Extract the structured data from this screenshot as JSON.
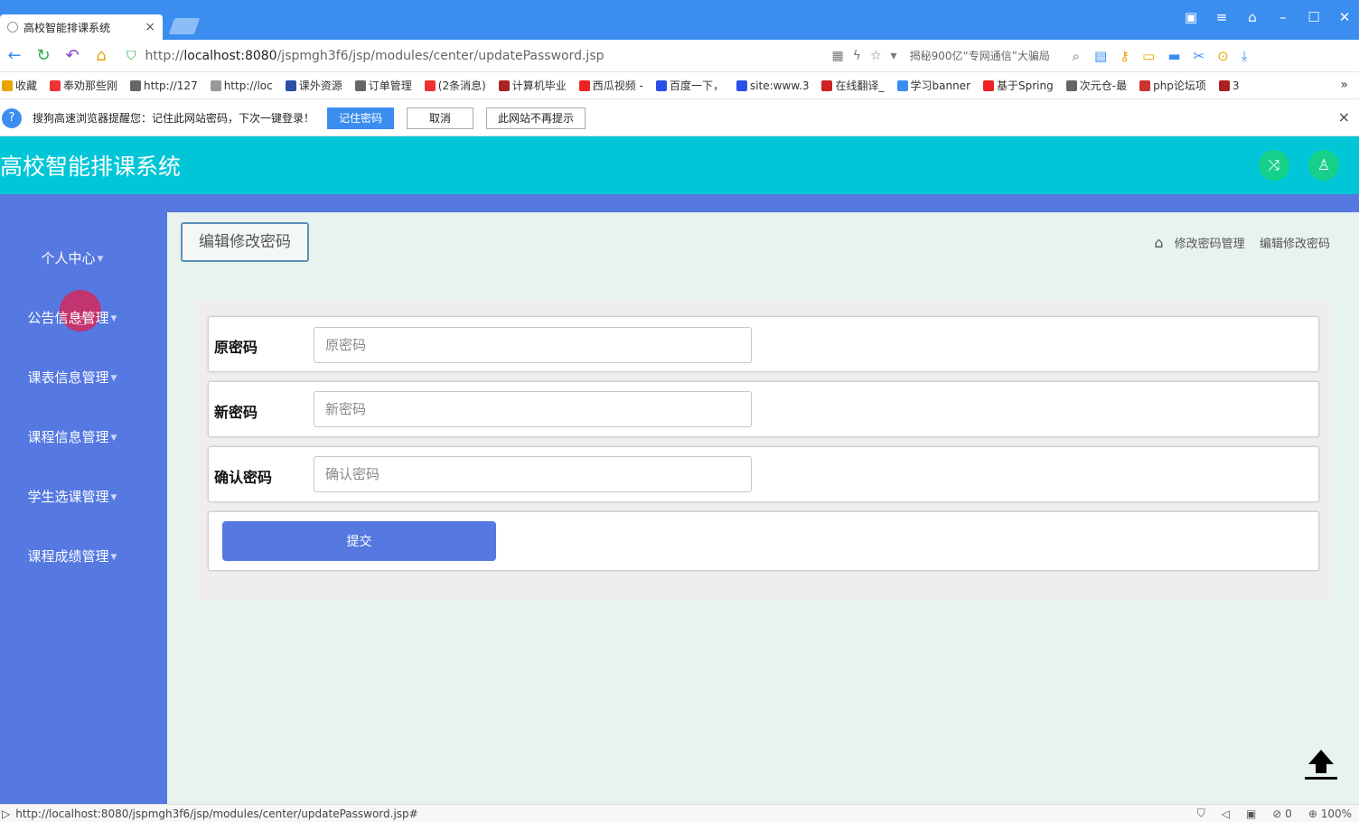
{
  "browser": {
    "tab_title": "高校智能排课系统",
    "tab_close": "×",
    "url_prefix": "http://",
    "url_host": "localhost:8080",
    "url_path": "/jspmgh3f6/jsp/modules/center/updatePassword.jsp",
    "search_hint": "揭秘900亿“专网通信”大骗局",
    "bookmarks": [
      {
        "label": "收藏",
        "color": "#e8a400"
      },
      {
        "label": "奉劝那些刚",
        "color": "#e33"
      },
      {
        "label": "http://127",
        "color": "#666"
      },
      {
        "label": "http://loc",
        "color": "#999"
      },
      {
        "label": "课外资源",
        "color": "#2a4fa8"
      },
      {
        "label": "订单管理",
        "color": "#666"
      },
      {
        "label": "(2条消息)",
        "color": "#e33"
      },
      {
        "label": "计算机毕业",
        "color": "#a22"
      },
      {
        "label": "西瓜视频 -",
        "color": "#e22"
      },
      {
        "label": "百度一下，",
        "color": "#2a4fe8"
      },
      {
        "label": "site:www.3",
        "color": "#2a4fe8"
      },
      {
        "label": "在线翻译_",
        "color": "#c22"
      },
      {
        "label": "学习banner",
        "color": "#3b8ef0"
      },
      {
        "label": "基于Spring",
        "color": "#e22"
      },
      {
        "label": "次元仓-最",
        "color": "#666"
      },
      {
        "label": "php论坛项",
        "color": "#c33"
      },
      {
        "label": "3",
        "color": "#a22"
      }
    ],
    "notification": {
      "text": "搜狗高速浏览器提醒您：记住此网站密码，下次一键登录！",
      "remember_label": "记住密码",
      "cancel_label": "取消",
      "never_label": "此网站不再提示",
      "close": "×"
    },
    "status_url": "http://localhost:8080/jspmgh3f6/jsp/modules/center/updatePassword.jsp#",
    "status_count": "0",
    "zoom": "100%"
  },
  "header": {
    "title": "高校智能排课系统"
  },
  "sidebar": {
    "items": [
      {
        "label": "个人中心"
      },
      {
        "label": "公告信息管理"
      },
      {
        "label": "课表信息管理"
      },
      {
        "label": "课程信息管理"
      },
      {
        "label": "学生选课管理"
      },
      {
        "label": "课程成绩管理"
      }
    ]
  },
  "page": {
    "title": "编辑修改密码",
    "breadcrumb": [
      "修改密码管理",
      "编辑修改密码"
    ]
  },
  "form": {
    "old_password": {
      "label": "原密码",
      "placeholder": "原密码"
    },
    "new_password": {
      "label": "新密码",
      "placeholder": "新密码"
    },
    "confirm_password": {
      "label": "确认密码",
      "placeholder": "确认密码"
    },
    "submit_label": "提交"
  },
  "colors": {
    "header": "#00c6d8",
    "sidebar": "#5578e1",
    "accent_button": "#5578e1",
    "header_icon_bg": "#16d08a"
  }
}
